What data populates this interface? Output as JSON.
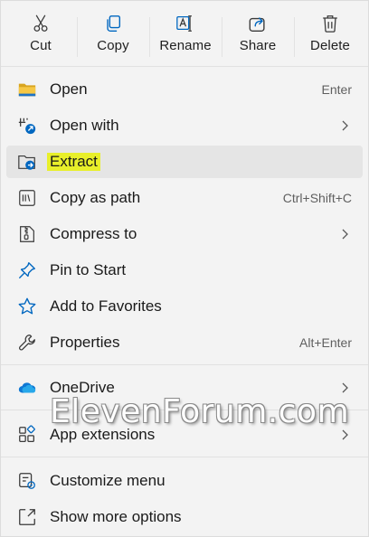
{
  "toolbar": {
    "cut": "Cut",
    "copy": "Copy",
    "rename": "Rename",
    "share": "Share",
    "delete": "Delete"
  },
  "items": {
    "open": {
      "label": "Open",
      "shortcut": "Enter",
      "icon": "folder-icon"
    },
    "open_with": {
      "label": "Open with",
      "icon": "open-with-icon"
    },
    "extract": {
      "label": "Extract",
      "icon": "extract-icon",
      "highlight": "#e8ef2a"
    },
    "copy_path": {
      "label": "Copy as path",
      "shortcut": "Ctrl+Shift+C",
      "icon": "copy-path-icon"
    },
    "compress": {
      "label": "Compress to",
      "icon": "compress-icon"
    },
    "pin_start": {
      "label": "Pin to Start",
      "icon": "pin-icon"
    },
    "favorites": {
      "label": "Add to Favorites",
      "icon": "star-icon"
    },
    "properties": {
      "label": "Properties",
      "shortcut": "Alt+Enter",
      "icon": "wrench-icon"
    },
    "onedrive": {
      "label": "OneDrive",
      "icon": "onedrive-icon"
    },
    "app_ext": {
      "label": "App extensions",
      "icon": "app-extensions-icon"
    },
    "customize": {
      "label": "Customize menu",
      "icon": "customize-icon"
    },
    "more": {
      "label": "Show more options",
      "icon": "more-options-icon"
    }
  },
  "watermark": "ElevenForum.com",
  "colors": {
    "accent": "#0067c0",
    "menu_bg": "#f3f3f3",
    "hover_bg": "#e5e5e5",
    "highlight": "#e8ef2a"
  }
}
